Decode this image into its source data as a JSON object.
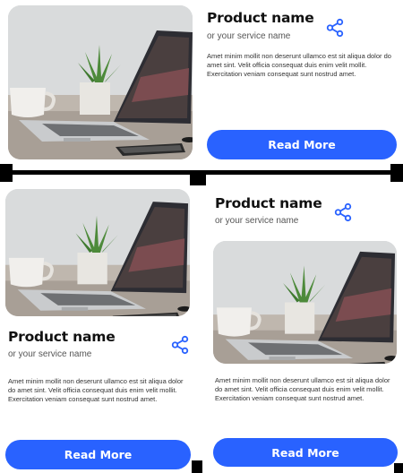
{
  "colors": {
    "accent": "#2962ff",
    "divider": "#000000"
  },
  "cards": [
    {
      "title": "Product name",
      "subtitle": "or your service name",
      "description": "Amet minim mollit non deserunt ullamco est sit aliqua dolor do amet sint. Velit officia consequat duis enim velit mollit. Exercitation veniam consequat sunt nostrud amet.",
      "button_label": "Read More",
      "share_icon": "share-icon",
      "image": "laptop-on-desk-photo"
    },
    {
      "title": "Product name",
      "subtitle": "or your service name",
      "description": "Amet minim mollit non deserunt ullamco est sit aliqua dolor do amet sint. Velit officia consequat duis enim velit mollit. Exercitation veniam consequat sunt nostrud amet.",
      "button_label": "Read More",
      "share_icon": "share-icon",
      "image": "laptop-on-desk-photo"
    },
    {
      "title": "Product name",
      "subtitle": "or your service name",
      "description": "Amet minim mollit non deserunt ullamco est sit aliqua dolor do amet sint. Velit officia consequat duis enim velit mollit. Exercitation veniam consequat sunt nostrud amet.",
      "button_label": "Read More",
      "share_icon": "share-icon",
      "image": "laptop-on-desk-photo"
    }
  ]
}
